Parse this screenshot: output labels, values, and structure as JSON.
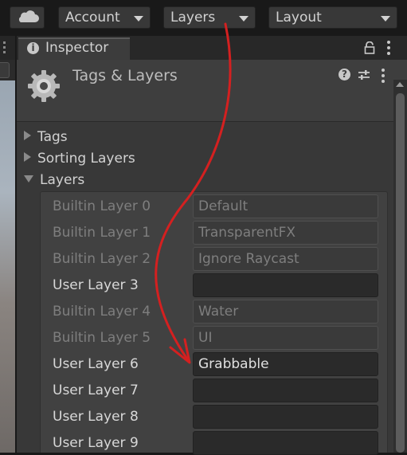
{
  "toolbar": {
    "cloud_icon": "cloud-icon",
    "account_label": "Account",
    "layers_label": "Layers",
    "layout_label": "Layout"
  },
  "inspector": {
    "tab_label": "Inspector",
    "title": "Tags & Layers",
    "sections": {
      "tags": "Tags",
      "sorting_layers": "Sorting Layers",
      "layers": "Layers"
    },
    "layers": [
      {
        "label": "Builtin Layer 0",
        "value": "Default",
        "editable": false
      },
      {
        "label": "Builtin Layer 1",
        "value": "TransparentFX",
        "editable": false
      },
      {
        "label": "Builtin Layer 2",
        "value": "Ignore Raycast",
        "editable": false
      },
      {
        "label": "User Layer 3",
        "value": "",
        "editable": true
      },
      {
        "label": "Builtin Layer 4",
        "value": "Water",
        "editable": false
      },
      {
        "label": "Builtin Layer 5",
        "value": "UI",
        "editable": false
      },
      {
        "label": "User Layer 6",
        "value": "Grabbable",
        "editable": true
      },
      {
        "label": "User Layer 7",
        "value": "",
        "editable": true
      },
      {
        "label": "User Layer 8",
        "value": "",
        "editable": true
      },
      {
        "label": "User Layer 9",
        "value": "",
        "editable": true
      }
    ]
  },
  "annotation": {
    "color": "#d42020"
  }
}
